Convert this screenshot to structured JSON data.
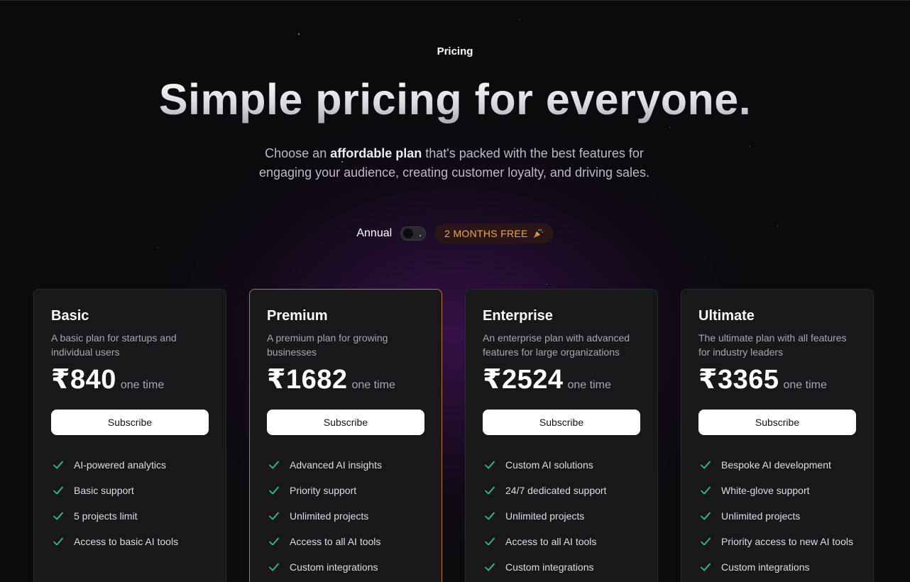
{
  "hero": {
    "eyebrow": "Pricing",
    "title": "Simple pricing for everyone.",
    "subtitle_pre": "Choose an ",
    "subtitle_bold": "affordable plan",
    "subtitle_post": " that's packed with the best features for engaging your audience, creating customer loyalty, and driving sales."
  },
  "billing": {
    "label": "Annual",
    "toggle_on": false,
    "promo": "2 MONTHS FREE",
    "promo_icon": "party-popper-icon"
  },
  "colors": {
    "background": "#0b0a0d",
    "card": "#18181b",
    "featured_border": "#b8782c",
    "check": "#22c58b",
    "promo_text": "#f0a541"
  },
  "plans": [
    {
      "name": "Basic",
      "description": "A basic plan for startups and individual users",
      "price": "₹840",
      "period": "one time",
      "cta": "Subscribe",
      "featured": false,
      "features": [
        "AI-powered analytics",
        "Basic support",
        "5 projects limit",
        "Access to basic AI tools"
      ]
    },
    {
      "name": "Premium",
      "description": "A premium plan for growing businesses",
      "price": "₹1682",
      "period": "one time",
      "cta": "Subscribe",
      "featured": true,
      "features": [
        "Advanced AI insights",
        "Priority support",
        "Unlimited projects",
        "Access to all AI tools",
        "Custom integrations"
      ]
    },
    {
      "name": "Enterprise",
      "description": "An enterprise plan with advanced features for large organizations",
      "price": "₹2524",
      "period": "one time",
      "cta": "Subscribe",
      "featured": false,
      "features": [
        "Custom AI solutions",
        "24/7 dedicated support",
        "Unlimited projects",
        "Access to all AI tools",
        "Custom integrations"
      ]
    },
    {
      "name": "Ultimate",
      "description": "The ultimate plan with all features for industry leaders",
      "price": "₹3365",
      "period": "one time",
      "cta": "Subscribe",
      "featured": false,
      "features": [
        "Bespoke AI development",
        "White-glove support",
        "Unlimited projects",
        "Priority access to new AI tools",
        "Custom integrations"
      ]
    }
  ]
}
